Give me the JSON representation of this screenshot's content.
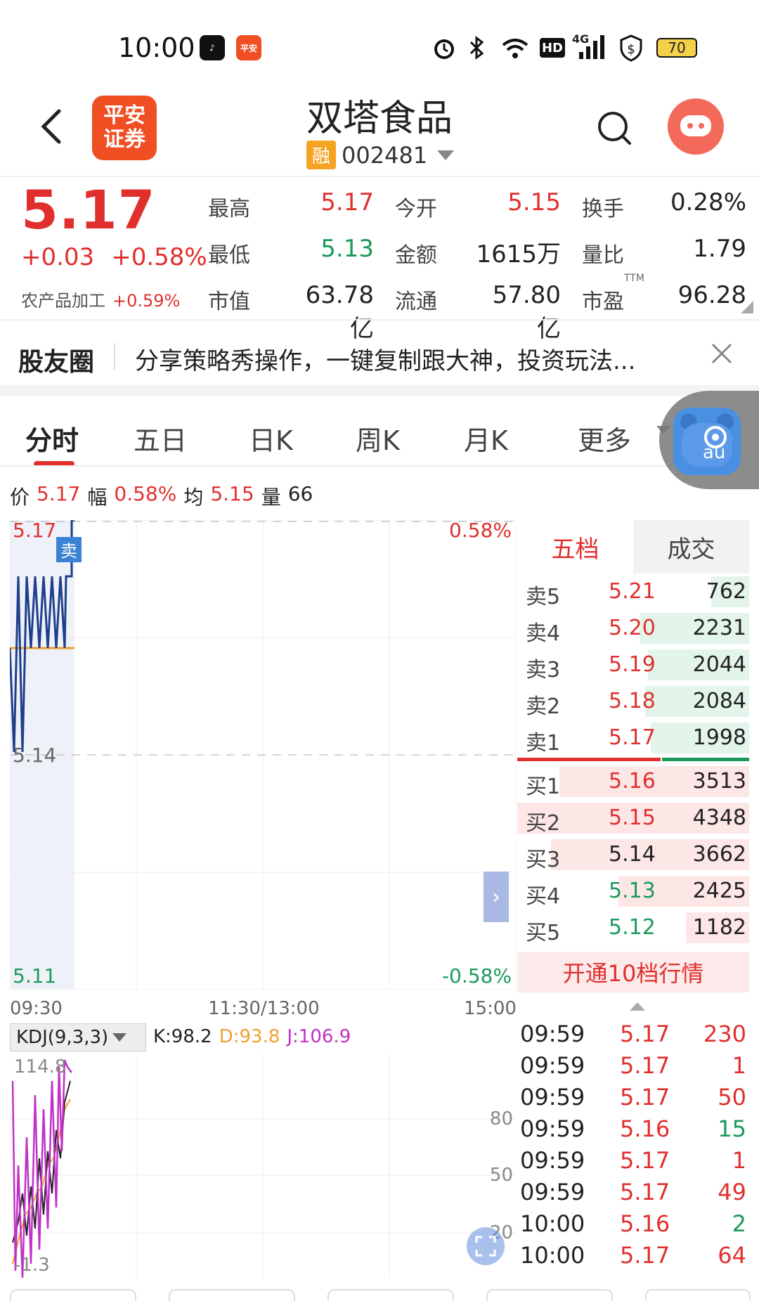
{
  "status_bar": {
    "time": "10:00",
    "battery": "70",
    "network": "4G",
    "hd": "HD"
  },
  "header": {
    "logo_line1": "平安",
    "logo_line2": "证券",
    "stock_name": "双塔食品",
    "margin_badge": "融",
    "stock_code": "002481"
  },
  "quote": {
    "price": "5.17",
    "change": "+0.03",
    "change_pct": "+0.58%",
    "sector": "农产品加工",
    "sector_pct": "+0.59%",
    "fields": [
      {
        "label": "最高",
        "value": "5.17",
        "color": "red"
      },
      {
        "label": "今开",
        "value": "5.15",
        "color": "red"
      },
      {
        "label": "换手",
        "value": "0.28%",
        "color": "black"
      },
      {
        "label": "最低",
        "value": "5.13",
        "color": "green"
      },
      {
        "label": "金额",
        "value": "1615万",
        "color": "black"
      },
      {
        "label": "量比",
        "value": "1.79",
        "color": "black"
      },
      {
        "label": "市值",
        "value": "63.78亿",
        "color": "black"
      },
      {
        "label": "流通",
        "value": "57.80亿",
        "color": "black"
      },
      {
        "label": "市盈",
        "value": "96.28",
        "color": "black",
        "sup": "TTM"
      }
    ]
  },
  "community": {
    "title": "股友圈",
    "text": "分享策略秀操作，一键复制跟大神，投资玩法..."
  },
  "tabs": [
    "分时",
    "五日",
    "日K",
    "周K",
    "月K",
    "更多"
  ],
  "info_line": {
    "price_label": "价",
    "price": "5.17",
    "amp_label": "幅",
    "amp": "0.58%",
    "avg_label": "均",
    "avg": "5.15",
    "vol_label": "量",
    "vol": "66"
  },
  "chart": {
    "y_top": "5.17",
    "y_mid": "5.14",
    "y_bottom": "5.11",
    "pct_top": "0.58%",
    "pct_bottom": "-0.58%",
    "sell_marker": "卖",
    "time_labels": [
      "09:30",
      "11:30/13:00",
      "15:00"
    ]
  },
  "kdj": {
    "label": "KDJ(9,3,3)",
    "k": "K:98.2",
    "d": "D:93.8",
    "j": "J:106.9",
    "top": "114.8",
    "bottom": "-1.3",
    "lines": [
      "80",
      "50",
      "20"
    ]
  },
  "order_book": {
    "tabs": [
      "五档",
      "成交"
    ],
    "sells": [
      {
        "label": "卖5",
        "price": "5.21",
        "vol": "762",
        "color": "red",
        "bar": 0.18
      },
      {
        "label": "卖4",
        "price": "5.20",
        "vol": "2231",
        "color": "red",
        "bar": 0.52
      },
      {
        "label": "卖3",
        "price": "5.19",
        "vol": "2044",
        "color": "red",
        "bar": 0.48
      },
      {
        "label": "卖2",
        "price": "5.18",
        "vol": "2084",
        "color": "red",
        "bar": 0.49
      },
      {
        "label": "卖1",
        "price": "5.17",
        "vol": "1998",
        "color": "red",
        "bar": 0.47
      }
    ],
    "buys": [
      {
        "label": "买1",
        "price": "5.16",
        "vol": "3513",
        "color": "red",
        "bar": 0.82
      },
      {
        "label": "买2",
        "price": "5.15",
        "vol": "4348",
        "color": "red",
        "bar": 1.0
      },
      {
        "label": "买3",
        "price": "5.14",
        "vol": "3662",
        "color": "black",
        "bar": 0.85
      },
      {
        "label": "买4",
        "price": "5.13",
        "vol": "2425",
        "color": "green",
        "bar": 0.57
      },
      {
        "label": "买5",
        "price": "5.12",
        "vol": "1182",
        "color": "green",
        "bar": 0.28
      }
    ],
    "open10": "开通10档行情"
  },
  "ticks": [
    {
      "time": "09:59",
      "price": "5.17",
      "vol": "230",
      "pc": "red",
      "vc": "red"
    },
    {
      "time": "09:59",
      "price": "5.17",
      "vol": "1",
      "pc": "red",
      "vc": "red"
    },
    {
      "time": "09:59",
      "price": "5.17",
      "vol": "50",
      "pc": "red",
      "vc": "red"
    },
    {
      "time": "09:59",
      "price": "5.16",
      "vol": "15",
      "pc": "red",
      "vc": "green"
    },
    {
      "time": "09:59",
      "price": "5.17",
      "vol": "1",
      "pc": "red",
      "vc": "red"
    },
    {
      "time": "09:59",
      "price": "5.17",
      "vol": "49",
      "pc": "red",
      "vc": "red"
    },
    {
      "time": "10:00",
      "price": "5.16",
      "vol": "2",
      "pc": "red",
      "vc": "green"
    },
    {
      "time": "10:00",
      "price": "5.17",
      "vol": "64",
      "pc": "red",
      "vc": "red"
    }
  ],
  "colors": {
    "up": "#e0302e",
    "down": "#1a9a5a",
    "line": "#1f3f8c",
    "avg": "#f0a030",
    "k": "#222222",
    "d": "#f0a030",
    "j": "#c030c8"
  }
}
